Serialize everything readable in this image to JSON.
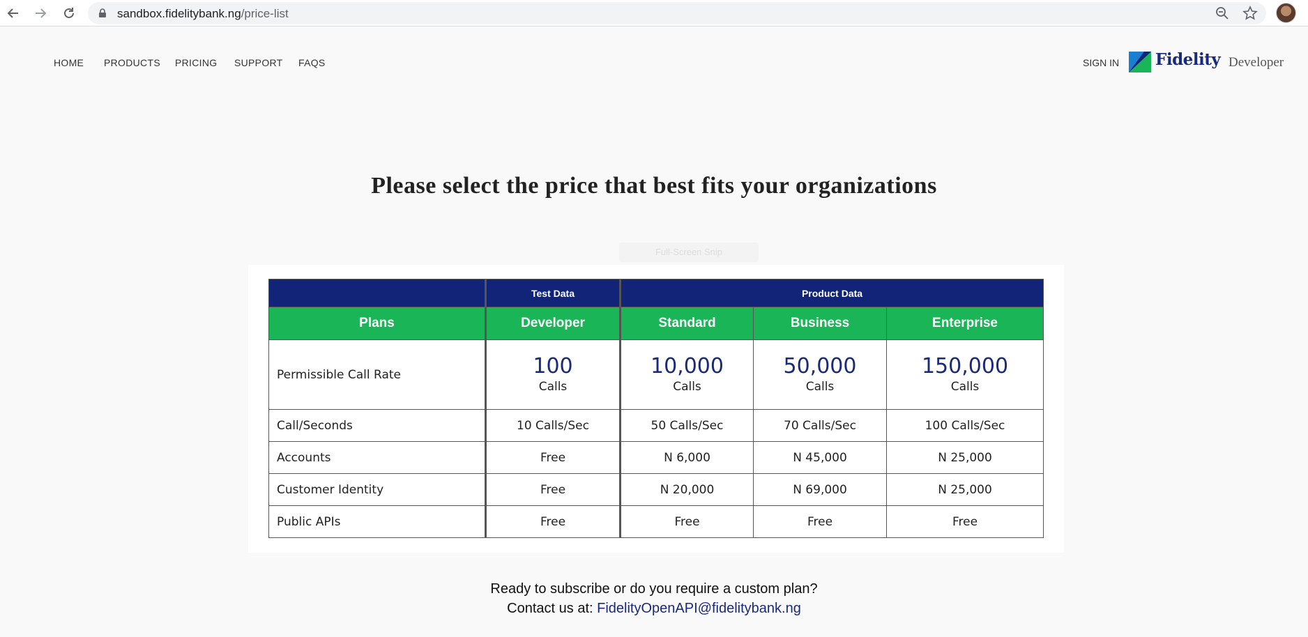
{
  "browser": {
    "url_domain": "sandbox.fidelitybank.ng",
    "url_path": "/price-list"
  },
  "nav": {
    "links": [
      "HOME",
      "PRODUCTS",
      "PRICING",
      "SUPPORT",
      "FAQS"
    ],
    "signin": "SIGN IN",
    "logo_text": "Fidelity",
    "logo_sub": "Developer"
  },
  "page": {
    "title": "Please select the price that best fits your organizations",
    "ghost_button": "Full-Screen Snip"
  },
  "table": {
    "groups": {
      "test": "Test Data",
      "product": "Product Data"
    },
    "headers": [
      "Plans",
      "Developer",
      "Standard",
      "Business",
      "Enterprise"
    ],
    "rate_row": {
      "label": "Permissible Call Rate",
      "values": [
        "100",
        "10,000",
        "50,000",
        "150,000"
      ],
      "unit": "Calls"
    },
    "rows": [
      {
        "label": "Call/Seconds",
        "cells": [
          "10 Calls/Sec",
          "50 Calls/Sec",
          "70 Calls/Sec",
          "100 Calls/Sec"
        ]
      },
      {
        "label": "Accounts",
        "cells": [
          "Free",
          "N 6,000",
          "N 45,000",
          "N 25,000"
        ]
      },
      {
        "label": "Customer Identity",
        "cells": [
          "Free",
          "N 20,000",
          "N 69,000",
          "N 25,000"
        ]
      },
      {
        "label": "Public APIs",
        "cells": [
          "Free",
          "Free",
          "Free",
          "Free"
        ]
      }
    ]
  },
  "footer": {
    "cta": "Ready to subscribe or do you require a custom plan?",
    "contact_prefix": "Contact us at:",
    "email": "FidelityOpenAPI@fidelitybank.ng"
  },
  "colors": {
    "header_blue": "#112478",
    "plan_green": "#1ab556",
    "accent_text": "#1a2a7a"
  }
}
